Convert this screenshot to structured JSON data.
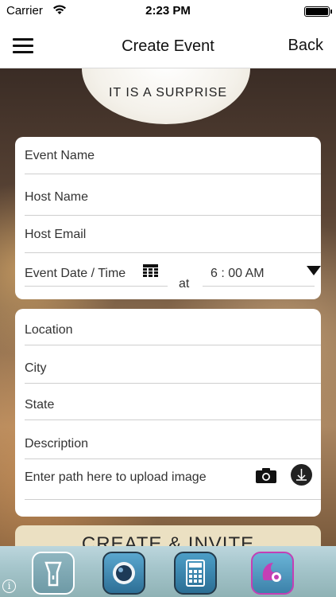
{
  "status_bar": {
    "carrier": "Carrier",
    "time": "2:23 PM"
  },
  "nav": {
    "title": "Create Event",
    "back_label": "Back"
  },
  "banner": {
    "text": "IT IS A SURPRISE"
  },
  "form1": {
    "event_name_placeholder": "Event Name",
    "host_name_placeholder": "Host Name",
    "host_email_placeholder": "Host Email",
    "event_datetime_placeholder": "Event Date / Time",
    "at_label": "at",
    "time_value": "6 : 00 AM"
  },
  "form2": {
    "location_placeholder": "Location",
    "city_placeholder": "City",
    "state_placeholder": "State",
    "description_placeholder": "Description",
    "upload_placeholder": "Enter path here to upload image"
  },
  "create_button": {
    "label": "CREATE & INVITE"
  },
  "dock": {
    "info_label": "i",
    "apps": [
      "flashlight-icon",
      "camera-lens-icon",
      "calculator-icon",
      "squirrel-icon"
    ]
  },
  "colors": {
    "create_button_bg": "#ebe0c2",
    "brand_accent": "#c43fb5"
  }
}
